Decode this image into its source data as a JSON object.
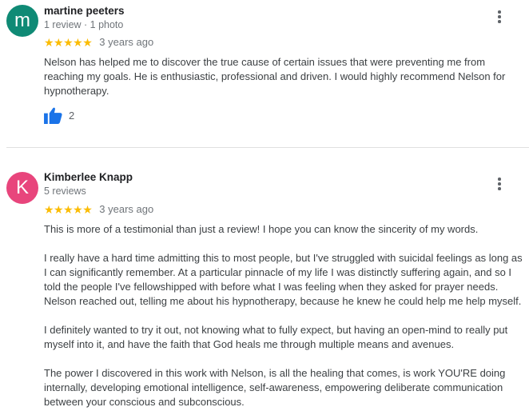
{
  "reviews": [
    {
      "avatar_letter": "m",
      "avatar_color": "#0f8a75",
      "name": "martine peeters",
      "meta": "1 review · 1 photo",
      "stars": "★★★★★",
      "rating": 5,
      "date": "3 years ago",
      "paragraphs": [
        "Nelson has helped me to discover the true cause of certain issues that were preventing me from reaching my goals. He is enthusiastic, professional and driven. I would highly recommend Nelson for hypnotherapy."
      ],
      "likes": "2"
    },
    {
      "avatar_letter": "K",
      "avatar_color": "#e8457c",
      "name": "Kimberlee Knapp",
      "meta": "5 reviews",
      "stars": "★★★★★",
      "rating": 5,
      "date": "3 years ago",
      "paragraphs": [
        "This is more of a testimonial than just a review! I hope you can know the sincerity of my words.",
        "I really have a hard time admitting this to most people, but I've struggled with suicidal feelings as long as I can significantly remember. At a particular pinnacle of my life I was distinctly suffering again, and so I told the people I've fellowshipped with before what I was feeling when they asked for prayer needs. Nelson reached out, telling me about his hypnotherapy, because he knew he could help me help myself.",
        "I definitely wanted to try it out, not knowing what to fully expect, but having an open-mind to really put myself into it, and have the faith that God heals me through multiple means and avenues.",
        "The power I discovered in this work with Nelson, is all the healing that comes, is work YOU'RE doing internally, developing emotional intelligence, self-awareness, empowering deliberate communication between your conscious and subconscious."
      ]
    }
  ],
  "icons": {
    "menu": "more-vert-icon",
    "like": "thumb-up-icon"
  },
  "colors": {
    "star": "#fbbc04",
    "like": "#1a73e8"
  }
}
